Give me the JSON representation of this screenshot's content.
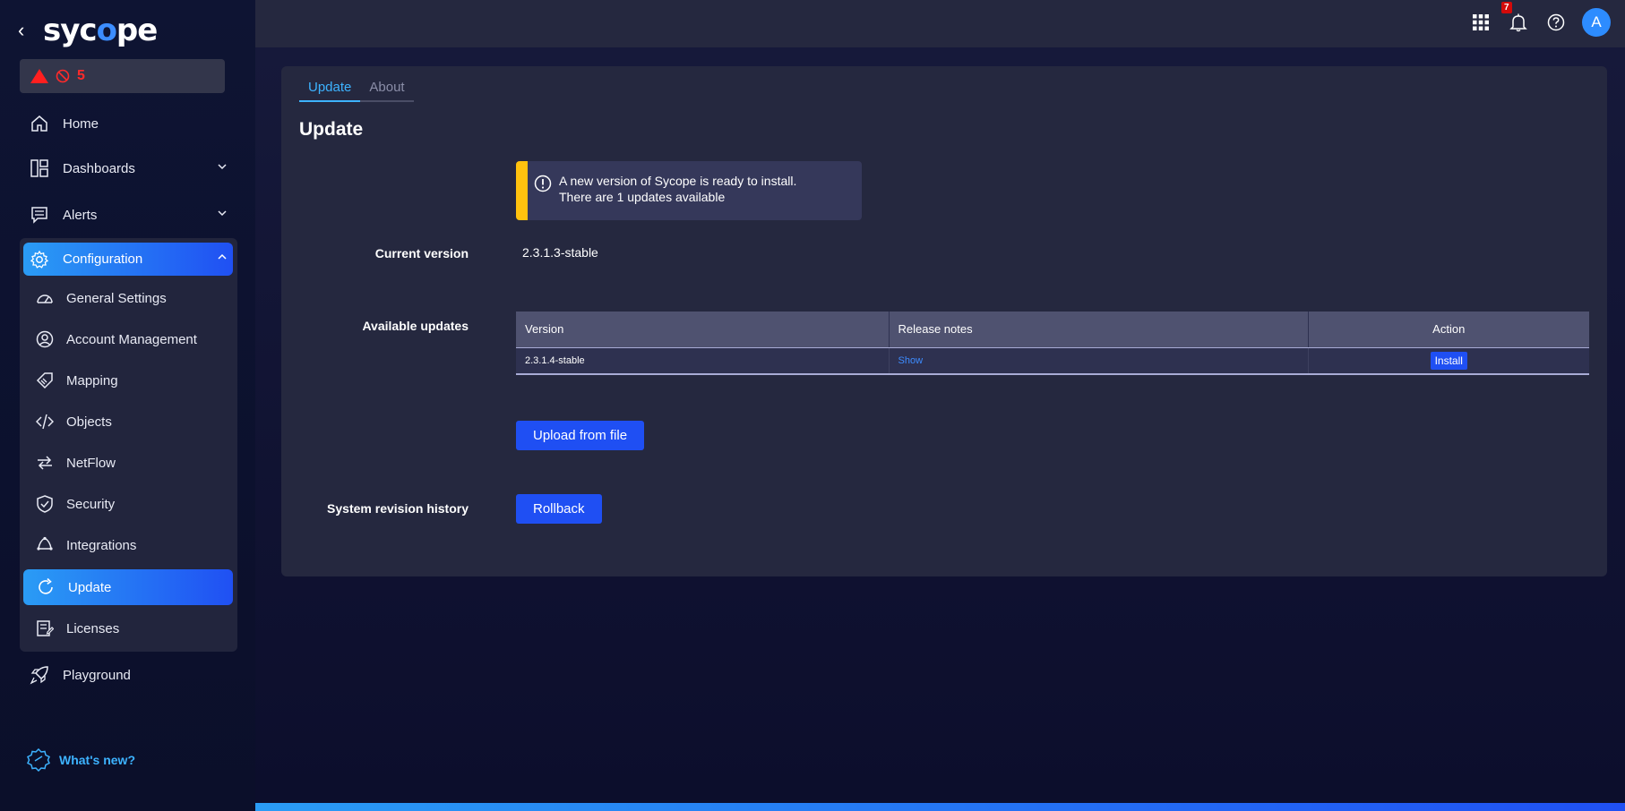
{
  "brand": {
    "logo_text_1": "syc",
    "logo_text_o": "o",
    "logo_text_2": "pe"
  },
  "alert_box": {
    "count": "5"
  },
  "nav": {
    "home": "Home",
    "dashboards": "Dashboards",
    "alerts": "Alerts",
    "configuration": "Configuration",
    "playground": "Playground"
  },
  "config_items": {
    "general_settings": "General Settings",
    "account_management": "Account Management",
    "mapping": "Mapping",
    "objects": "Objects",
    "netflow": "NetFlow",
    "security": "Security",
    "integrations": "Integrations",
    "update": "Update",
    "licenses": "Licenses"
  },
  "whats_new": "What's new?",
  "topbar": {
    "notification_count": "7",
    "avatar_initial": "A"
  },
  "tabs": {
    "update": "Update",
    "about": "About"
  },
  "page_title": "Update",
  "notice": {
    "line1": "A new version of Sycope is ready to install.",
    "line2": "There are 1 updates available"
  },
  "labels": {
    "current_version": "Current version",
    "available_updates": "Available updates",
    "system_revision_history": "System revision history"
  },
  "current_version_value": "2.3.1.3-stable",
  "updates_table": {
    "headers": {
      "version": "Version",
      "release_notes": "Release notes",
      "action": "Action"
    },
    "rows": [
      {
        "version": "2.3.1.4-stable",
        "release_notes": "Show",
        "action": "Install"
      }
    ]
  },
  "buttons": {
    "upload": "Upload from file",
    "rollback": "Rollback"
  },
  "colors": {
    "accent": "#1f4ff3",
    "link": "#3d8cff",
    "warning": "#ffc20e",
    "alert": "#ff1f1f"
  }
}
